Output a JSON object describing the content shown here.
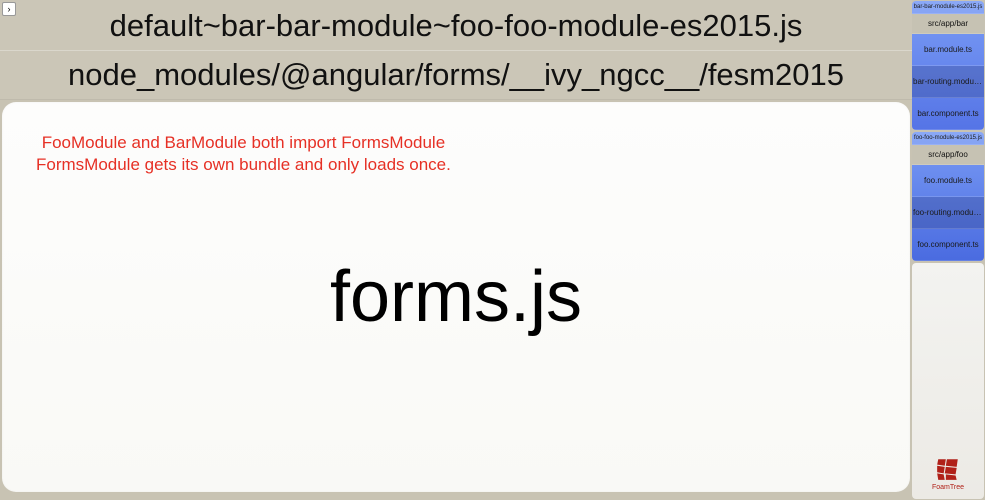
{
  "toggle": {
    "symbol": "›"
  },
  "headers": {
    "bundle_name": "default~bar-bar-module~foo-foo-module-es2015.js",
    "path": "node_modules/@angular/forms/__ivy_ngcc__/fesm2015"
  },
  "annotation": {
    "line1": "FooModule and BarModule both import FormsModule",
    "line2": "FormsModule gets its own bundle and only loads once."
  },
  "main_label": "forms.js",
  "sidebar": {
    "group1": {
      "title": "bar-bar-module-es2015.js",
      "name": "src/app/bar",
      "files": [
        "bar.module.ts",
        "bar-routing.module.ts",
        "bar.component.ts"
      ]
    },
    "group2": {
      "title": "foo-foo-module-es2015.js",
      "name": "src/app/foo",
      "files": [
        "foo.module.ts",
        "foo-routing.module.ts",
        "foo.component.ts"
      ]
    },
    "logo": {
      "label": "FoamTree"
    }
  }
}
